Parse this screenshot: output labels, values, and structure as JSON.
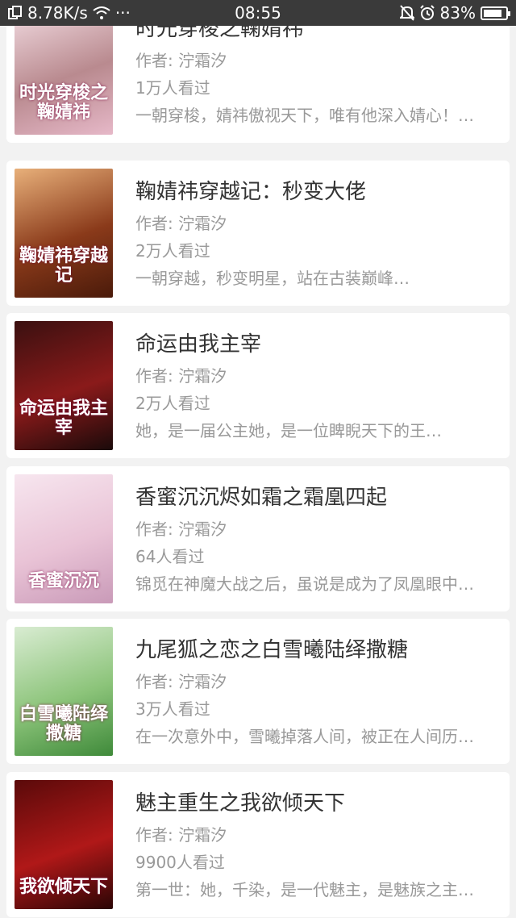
{
  "status_bar": {
    "speed": "8.78K/s",
    "more": "···",
    "time": "08:55",
    "battery": "83%",
    "battery_level": 0.83
  },
  "books": [
    {
      "title": "时光穿梭之鞠婧祎",
      "author": "作者: 泞霜汐",
      "reads": "1万人看过",
      "desc": "一朝穿梭，婧祎傲视天下，唯有他深入婧心！…",
      "cover_text": "时光穿梭之鞠婧祎",
      "cover_colors": [
        "#f3dde3",
        "#b98a8f",
        "#e6b8c8"
      ]
    },
    {
      "title": "鞠婧祎穿越记：秒变大佬",
      "author": "作者: 泞霜汐",
      "reads": "2万人看过",
      "desc": "一朝穿越，秒变明星，站在古装巅峰…",
      "cover_text": "鞠婧祎穿越记",
      "cover_colors": [
        "#e8b07a",
        "#8a3a1a",
        "#4a1a0a"
      ]
    },
    {
      "title": "命运由我主宰",
      "author": "作者: 泞霜汐",
      "reads": "2万人看过",
      "desc": "她，是一届公主她，是一位睥睨天下的王…",
      "cover_text": "命运由我主宰",
      "cover_colors": [
        "#3a1010",
        "#8a1a1a",
        "#1a0a0a"
      ]
    },
    {
      "title": "香蜜沉沉烬如霜之霜凰四起",
      "author": "作者: 泞霜汐",
      "reads": "64人看过",
      "desc": "锦觅在神魔大战之后，虽说是成为了凤凰眼中…",
      "cover_text": "香蜜沉沉",
      "cover_colors": [
        "#f7e6ef",
        "#e9c3d6",
        "#c99ab8"
      ]
    },
    {
      "title": "九尾狐之恋之白雪曦陆绎撒糖",
      "author": "作者: 泞霜汐",
      "reads": "3万人看过",
      "desc": "在一次意外中，雪曦掉落人间，被正在人间历…",
      "cover_text": "白雪曦陆绎撒糖",
      "cover_colors": [
        "#d9ecd2",
        "#8cc47a",
        "#3f8a3a"
      ]
    },
    {
      "title": "魅主重生之我欲倾天下",
      "author": "作者: 泞霜汐",
      "reads": "9900人看过",
      "desc": "第一世：她，千染，是一代魅主，是魅族之主…",
      "cover_text": "我欲倾天下",
      "cover_colors": [
        "#5a0a0a",
        "#b01818",
        "#2a0505"
      ]
    }
  ]
}
